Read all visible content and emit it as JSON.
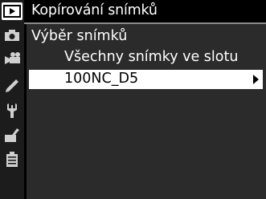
{
  "menu": {
    "title": "Kopírování snímků",
    "subtitle": "Výběr snímků",
    "items": [
      {
        "label": "Všechny snímky ve slotu",
        "selected": false
      },
      {
        "label": "100NC_D5",
        "selected": true,
        "has_submenu": true
      }
    ]
  },
  "sidebar": {
    "tabs": [
      {
        "icon": "playback-icon",
        "active": true
      },
      {
        "icon": "camera-icon",
        "active": false
      },
      {
        "icon": "movie-camera-icon",
        "active": false
      },
      {
        "icon": "pencil-icon",
        "active": false
      },
      {
        "icon": "wrench-icon",
        "active": false
      },
      {
        "icon": "retouch-icon",
        "active": false
      },
      {
        "icon": "recent-settings-icon",
        "active": false
      }
    ]
  },
  "colors": {
    "background": "#000000",
    "panel": "#2b2b2b",
    "sidebar": "#1c1c1c",
    "highlight": "#ffffff"
  }
}
